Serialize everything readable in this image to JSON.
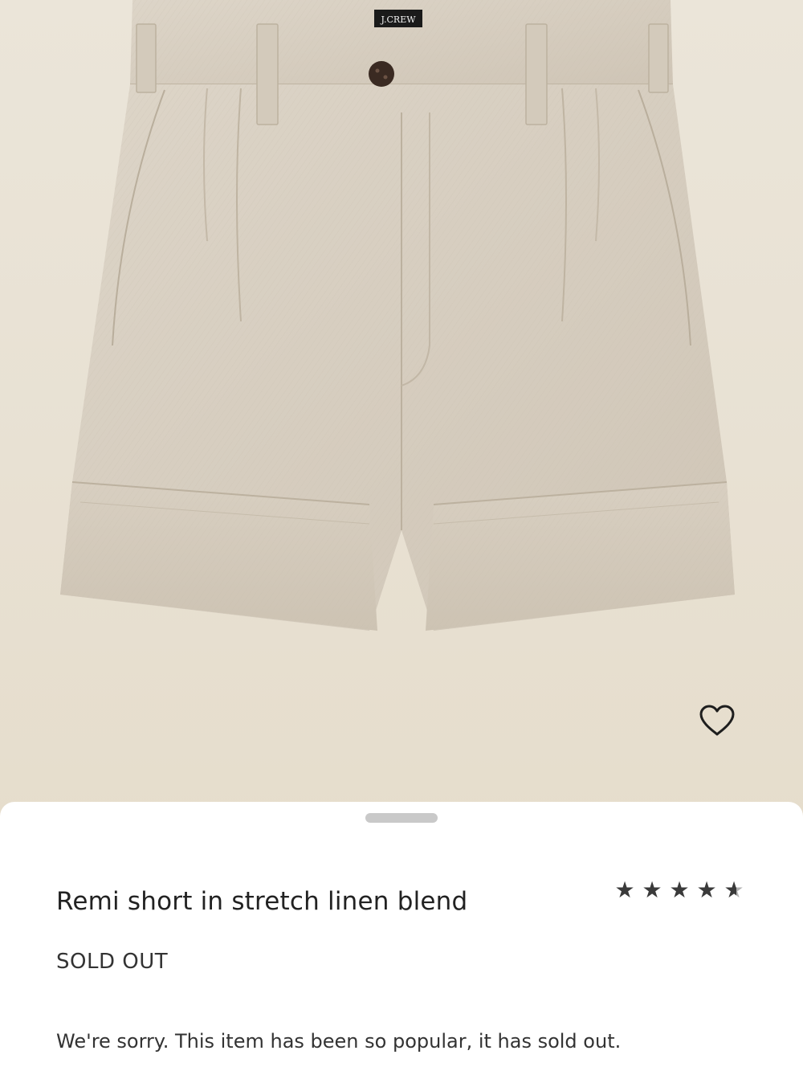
{
  "product": {
    "image_alt": "Remi short in stretch linen blend product photo",
    "brand_label": "J.CREW",
    "title": "Remi short in stretch linen blend",
    "status": "SOLD OUT",
    "message": "We're sorry. This item has been so popular, it has sold out.",
    "rating": {
      "value": 4.6,
      "max": 5
    }
  },
  "actions": {
    "wishlist_icon": "heart-outline-icon"
  },
  "colors": {
    "background": "#ebe5d9",
    "fabric": "#d9d0c2",
    "sheet": "#ffffff",
    "text": "#222222",
    "star": "#3a3a3a"
  }
}
